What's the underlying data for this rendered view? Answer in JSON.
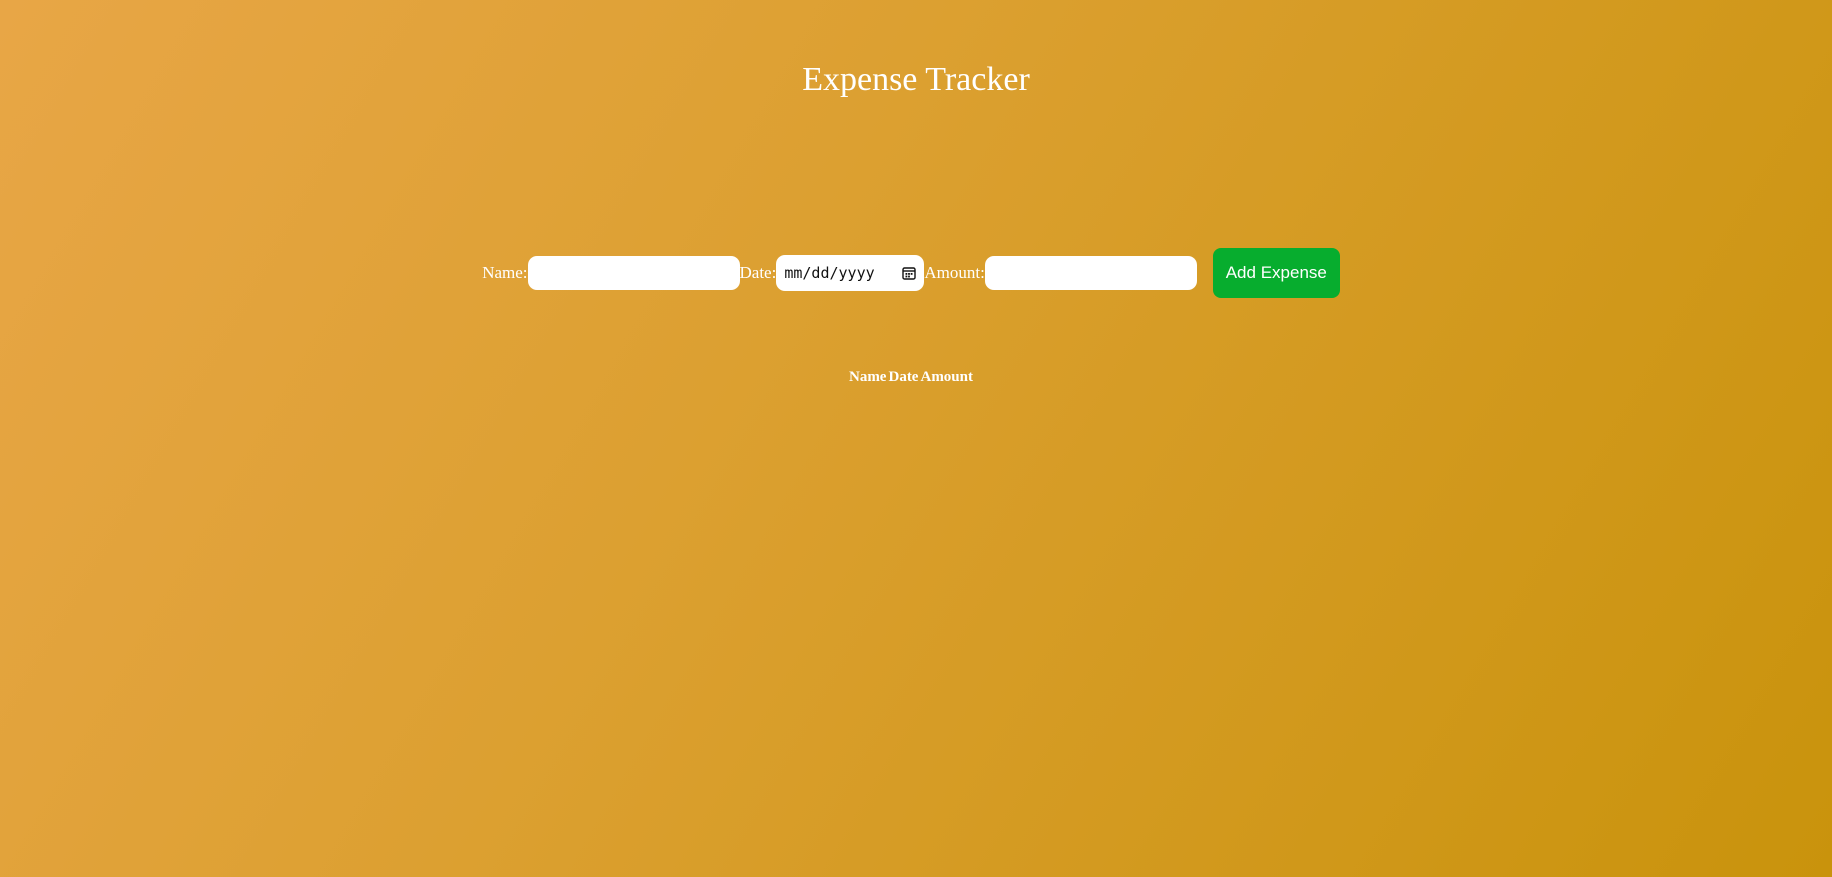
{
  "header": {
    "title": "Expense Tracker"
  },
  "form": {
    "name_label": "Name:",
    "name_value": "",
    "date_label": "Date:",
    "date_placeholder": "mm/dd/yyyy",
    "amount_label": "Amount:",
    "amount_value": "",
    "add_button_label": "Add Expense",
    "add_button_color": "#07ad2e"
  },
  "table": {
    "headers": [
      "Name",
      "Date",
      "Amount"
    ],
    "rows": []
  },
  "theme": {
    "background_start": "#e8a646",
    "background_end": "#c9930c",
    "text_color": "#ffffff"
  }
}
